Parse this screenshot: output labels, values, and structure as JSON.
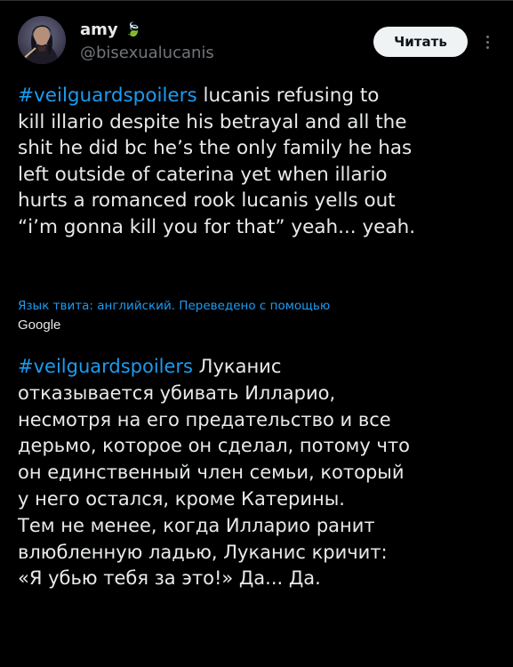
{
  "tweet": {
    "author": {
      "display_name": "amy",
      "name_emoji": "🍃",
      "handle": "@bisexualucanis"
    },
    "follow_label": "Читать",
    "original": {
      "lines": [
        {
          "hashtag": "#veilguardspoilers",
          "text": " lucanis refusing to"
        },
        {
          "hashtag": "",
          "text": "kill illario despite his betrayal and all the"
        },
        {
          "hashtag": "",
          "text": "shit he did bc he’s the only family he has"
        },
        {
          "hashtag": "",
          "text": "left outside of caterina yet when illario"
        },
        {
          "hashtag": "",
          "text": "hurts a romanced rook lucanis yells out"
        },
        {
          "hashtag": "",
          "text": "“i’m gonna kill you for that” yeah... yeah."
        }
      ]
    },
    "translation_note": "Язык твита: английский. Переведено с помощью",
    "translation_provider": "Google",
    "translated": {
      "lines": [
        {
          "hashtag": "#veilguardspoilers",
          "text": " Луканис"
        },
        {
          "hashtag": "",
          "text": "отказывается убивать Илларио,"
        },
        {
          "hashtag": "",
          "text": "несмотря на его предательство и все"
        },
        {
          "hashtag": "",
          "text": "дерьмо, которое он сделал, потому что"
        },
        {
          "hashtag": "",
          "text": "он единственный член семьи, который"
        },
        {
          "hashtag": "",
          "text": "у него остался, кроме Катерины."
        },
        {
          "hashtag": "",
          "text": "Тем не менее, когда Илларио ранит"
        },
        {
          "hashtag": "",
          "text": "влюбленную ладью, Луканис кричит:"
        },
        {
          "hashtag": "",
          "text": "«Я убью тебя за это!» Да... Да."
        }
      ]
    }
  },
  "colors": {
    "background": "#000000",
    "text": "#e7e9ea",
    "secondary": "#71767b",
    "accent": "#1d9bf0",
    "button_bg": "#eff3f4"
  },
  "icons": {
    "more": "more-vertical-icon"
  }
}
